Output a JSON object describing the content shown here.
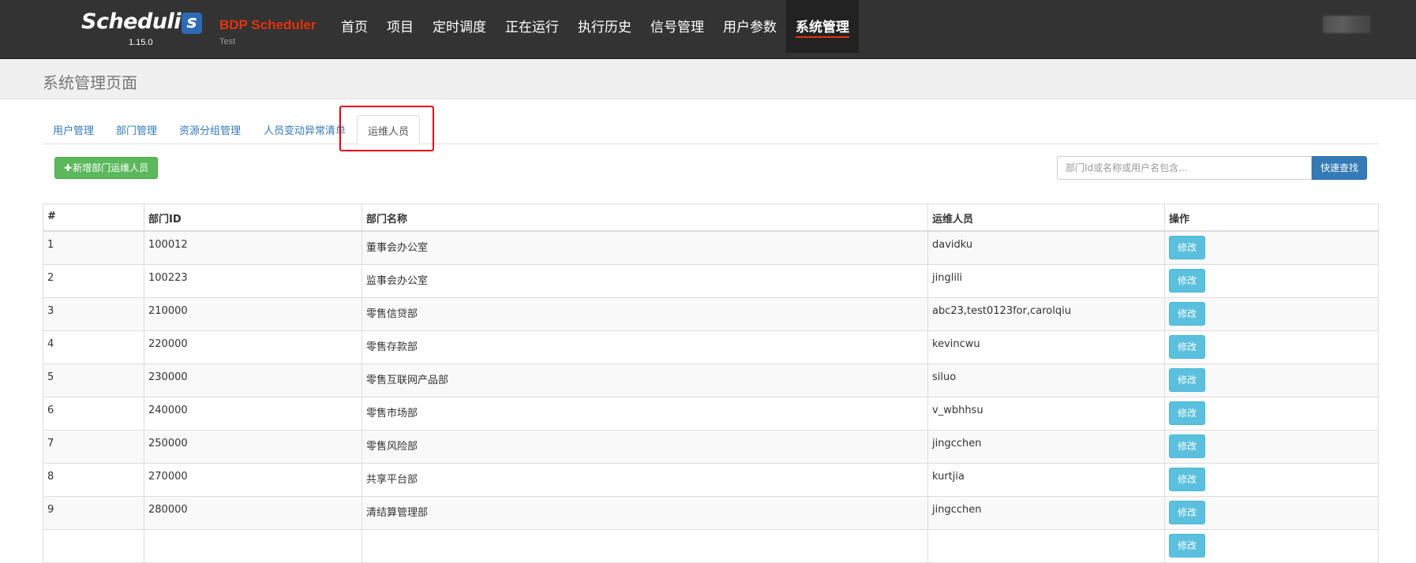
{
  "brand": {
    "logo_text": "Scheduli",
    "logo_badge": "s",
    "version": "1.15.0",
    "app_title": "BDP Scheduler",
    "env": "Test"
  },
  "nav": {
    "items": [
      {
        "label": "首页"
      },
      {
        "label": "项目"
      },
      {
        "label": "定时调度"
      },
      {
        "label": "正在运行"
      },
      {
        "label": "执行历史"
      },
      {
        "label": "信号管理"
      },
      {
        "label": "用户参数"
      },
      {
        "label": "系统管理",
        "active": true
      }
    ]
  },
  "page": {
    "title": "系统管理页面"
  },
  "tabs": [
    {
      "label": "用户管理"
    },
    {
      "label": "部门管理"
    },
    {
      "label": "资源分组管理"
    },
    {
      "label": "人员变动异常清单"
    },
    {
      "label": "运维人员",
      "active": true
    }
  ],
  "toolbar": {
    "add_label": "新增部门运维人员",
    "search_placeholder": "部门Id或名称或用户名包含...",
    "search_value": "",
    "search_button": "快速查找"
  },
  "table": {
    "headers": [
      "#",
      "部门ID",
      "部门名称",
      "运维人员",
      "操作"
    ],
    "edit_label": "修改",
    "rows": [
      {
        "idx": "1",
        "dept_id": "100012",
        "dept_name": "董事会办公室",
        "ops": "davidku"
      },
      {
        "idx": "2",
        "dept_id": "100223",
        "dept_name": "监事会办公室",
        "ops": "jinglili"
      },
      {
        "idx": "3",
        "dept_id": "210000",
        "dept_name": "零售信贷部",
        "ops": "abc23,test0123for,carolqiu"
      },
      {
        "idx": "4",
        "dept_id": "220000",
        "dept_name": "零售存款部",
        "ops": "kevincwu"
      },
      {
        "idx": "5",
        "dept_id": "230000",
        "dept_name": "零售互联网产品部",
        "ops": "siluo"
      },
      {
        "idx": "6",
        "dept_id": "240000",
        "dept_name": "零售市场部",
        "ops": "v_wbhhsu"
      },
      {
        "idx": "7",
        "dept_id": "250000",
        "dept_name": "零售风险部",
        "ops": "jingcchen"
      },
      {
        "idx": "8",
        "dept_id": "270000",
        "dept_name": "共享平台部",
        "ops": "kurtjia"
      },
      {
        "idx": "9",
        "dept_id": "280000",
        "dept_name": "清结算管理部",
        "ops": "jingcchen"
      },
      {
        "idx": "",
        "dept_id": "",
        "dept_name": "",
        "ops": ""
      }
    ]
  },
  "colors": {
    "navbar_bg": "#333333",
    "brand_red": "#e5320b",
    "link_blue": "#337ab7",
    "success_green": "#5cb85c",
    "info_cyan": "#5bc0de",
    "highlight_red": "#e60012"
  }
}
